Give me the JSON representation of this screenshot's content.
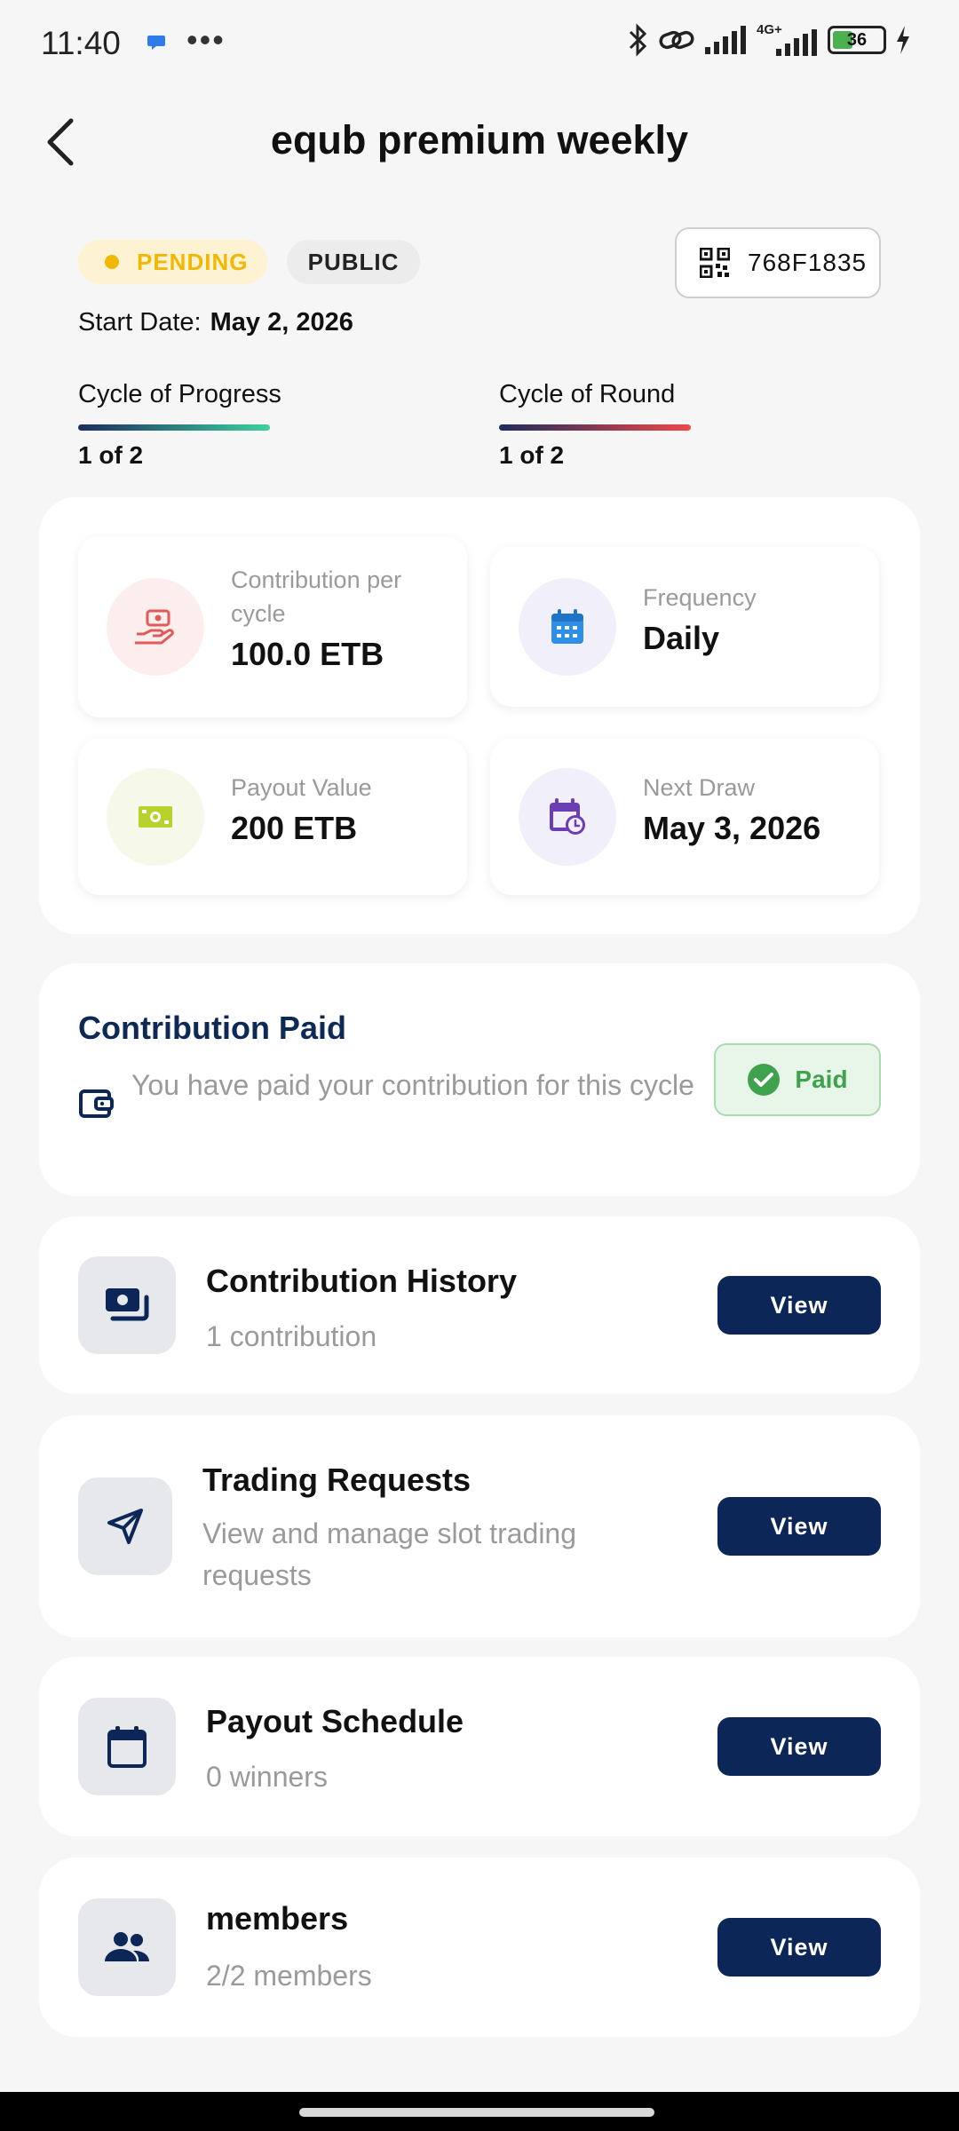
{
  "status_bar": {
    "time": "11:40",
    "dots": "•••",
    "network": "4G+",
    "battery": "36"
  },
  "header": {
    "title": "equb premium weekly"
  },
  "meta": {
    "status_badge": "PENDING",
    "visibility_badge": "PUBLIC",
    "code": "768F1835",
    "start_date_label": "Start Date:",
    "start_date_value": "May 2, 2026"
  },
  "progress": {
    "cycle_progress_label": "Cycle of Progress",
    "cycle_progress_value": "1 of 2",
    "cycle_round_label": "Cycle of Round",
    "cycle_round_value": "1 of 2"
  },
  "stats": {
    "contribution_label": "Contribution per cycle",
    "contribution_value": "100.0 ETB",
    "frequency_label": "Frequency",
    "frequency_value": "Daily",
    "payout_label": "Payout Value",
    "payout_value": "200 ETB",
    "next_draw_label": "Next Draw",
    "next_draw_value": "May 3, 2026"
  },
  "contribution_status": {
    "title": "Contribution Paid",
    "description": "You have paid your contribution for this cycle",
    "badge": "Paid"
  },
  "sections": [
    {
      "title": "Contribution History",
      "subtitle": "1 contribution",
      "button": "View",
      "icon": "money-stack-icon"
    },
    {
      "title": "Trading Requests",
      "subtitle": "View and manage slot trading requests",
      "button": "View",
      "icon": "send-icon"
    },
    {
      "title": "Payout Schedule",
      "subtitle": "0 winners",
      "button": "View",
      "icon": "calendar-icon"
    },
    {
      "title": "members",
      "subtitle": "2/2 members",
      "button": "View",
      "icon": "people-icon"
    }
  ],
  "colors": {
    "primary": "#0b2657",
    "pending": "#f2b705",
    "paid": "#3fa34d",
    "accent_red": "#e05a5a",
    "accent_blue": "#2f8fe8",
    "accent_purple": "#6b3fb3",
    "accent_lime": "#b8d12b"
  }
}
